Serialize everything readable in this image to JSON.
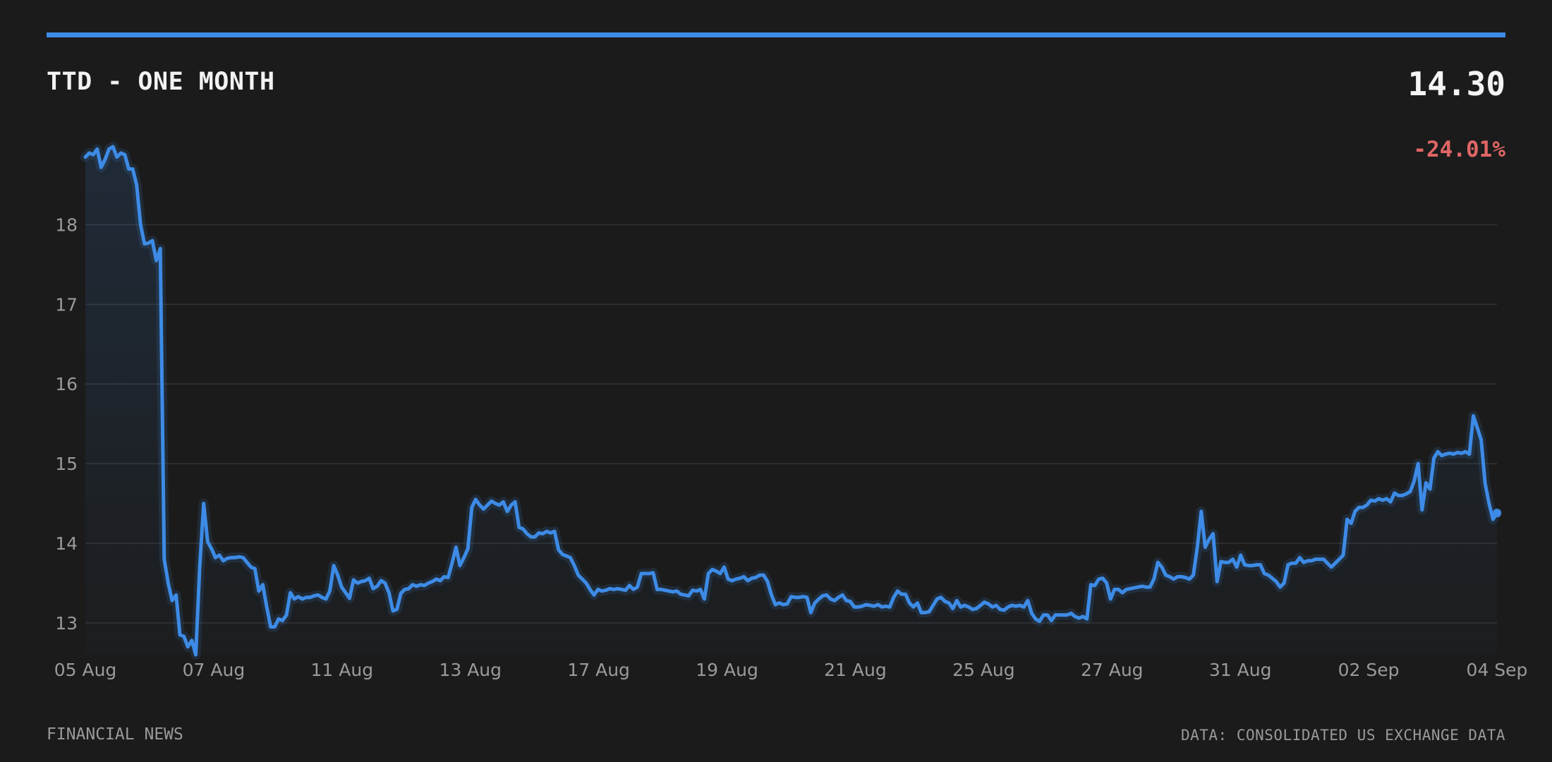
{
  "header": {
    "title": "TTD - ONE MONTH",
    "price": "14.30",
    "change": "-24.01%"
  },
  "footer": {
    "source": "FINANCIAL NEWS",
    "data_note": "DATA: CONSOLIDATED US EXCHANGE DATA"
  },
  "colors": {
    "background": "#1b1b1b",
    "accent": "#3d8be6",
    "negative": "#e06666",
    "grid": "#333333",
    "tick_text": "#9a9a9a"
  },
  "chart_data": {
    "type": "line",
    "title": "TTD - ONE MONTH",
    "ylim": [
      12.6,
      19.05
    ],
    "y_ticks": [
      13,
      14,
      15,
      16,
      17,
      18
    ],
    "x_ticks": [
      "05 Aug",
      "07 Aug",
      "11 Aug",
      "13 Aug",
      "17 Aug",
      "19 Aug",
      "21 Aug",
      "25 Aug",
      "27 Aug",
      "31 Aug",
      "02 Sep",
      "04 Sep"
    ],
    "grid": "horizontal",
    "series": [
      {
        "values": [
          18.85,
          18.9,
          18.88,
          18.95,
          18.72,
          18.82,
          18.95,
          18.98,
          18.85,
          18.9,
          18.88,
          18.7,
          18.7,
          18.5,
          18.0,
          17.76,
          17.77,
          17.8,
          17.55,
          17.7,
          13.8,
          13.5,
          13.28,
          13.35,
          12.85,
          12.83,
          12.7,
          12.78,
          12.6,
          13.7,
          14.5,
          14.02,
          13.93,
          13.82,
          13.85,
          13.78,
          13.81,
          13.82,
          13.82,
          13.83,
          13.82,
          13.76,
          13.7,
          13.68,
          13.4,
          13.48,
          13.2,
          12.95,
          12.95,
          13.05,
          13.03,
          13.1,
          13.38,
          13.3,
          13.33,
          13.3,
          13.32,
          13.32,
          13.34,
          13.35,
          13.32,
          13.3,
          13.4,
          13.72,
          13.6,
          13.45,
          13.38,
          13.31,
          13.54,
          13.5,
          13.52,
          13.53,
          13.56,
          13.43,
          13.46,
          13.53,
          13.5,
          13.38,
          13.15,
          13.17,
          13.37,
          13.42,
          13.43,
          13.48,
          13.46,
          13.48,
          13.47,
          13.5,
          13.52,
          13.55,
          13.53,
          13.58,
          13.57,
          13.75,
          13.95,
          13.72,
          13.82,
          13.93,
          14.45,
          14.55,
          14.48,
          14.43,
          14.48,
          14.53,
          14.5,
          14.48,
          14.52,
          14.4,
          14.48,
          14.52,
          14.2,
          14.18,
          14.12,
          14.08,
          14.08,
          14.13,
          14.12,
          14.15,
          14.13,
          14.15,
          13.92,
          13.86,
          13.84,
          13.82,
          13.72,
          13.6,
          13.55,
          13.5,
          13.42,
          13.35,
          13.42,
          13.4,
          13.41,
          13.43,
          13.42,
          13.43,
          13.42,
          13.41,
          13.47,
          13.42,
          13.45,
          13.62,
          13.62,
          13.62,
          13.63,
          13.42,
          13.42,
          13.41,
          13.4,
          13.39,
          13.4,
          13.36,
          13.35,
          13.34,
          13.41,
          13.4,
          13.42,
          13.3,
          13.62,
          13.67,
          13.65,
          13.62,
          13.7,
          13.55,
          13.53,
          13.55,
          13.56,
          13.58,
          13.53,
          13.56,
          13.57,
          13.6,
          13.6,
          13.52,
          13.35,
          13.23,
          13.25,
          13.23,
          13.24,
          13.33,
          13.32,
          13.32,
          13.33,
          13.32,
          13.13,
          13.25,
          13.3,
          13.34,
          13.35,
          13.3,
          13.28,
          13.32,
          13.35,
          13.28,
          13.27,
          13.2,
          13.2,
          13.21,
          13.23,
          13.22,
          13.21,
          13.23,
          13.2,
          13.21,
          13.2,
          13.32,
          13.4,
          13.36,
          13.36,
          13.25,
          13.2,
          13.25,
          13.13,
          13.13,
          13.14,
          13.22,
          13.3,
          13.32,
          13.27,
          13.25,
          13.18,
          13.28,
          13.2,
          13.22,
          13.2,
          13.17,
          13.18,
          13.22,
          13.26,
          13.24,
          13.2,
          13.22,
          13.17,
          13.16,
          13.2,
          13.22,
          13.21,
          13.22,
          13.2,
          13.28,
          13.12,
          13.05,
          13.02,
          13.1,
          13.1,
          13.03,
          13.1,
          13.1,
          13.1,
          13.1,
          13.12,
          13.08,
          13.06,
          13.08,
          13.05,
          13.48,
          13.47,
          13.55,
          13.56,
          13.5,
          13.3,
          13.42,
          13.42,
          13.38,
          13.42,
          13.43,
          13.44,
          13.45,
          13.46,
          13.45,
          13.45,
          13.55,
          13.76,
          13.7,
          13.6,
          13.58,
          13.55,
          13.58,
          13.58,
          13.57,
          13.55,
          13.6,
          13.95,
          14.4,
          13.95,
          14.05,
          14.12,
          13.52,
          13.77,
          13.76,
          13.76,
          13.8,
          13.7,
          13.85,
          13.73,
          13.72,
          13.72,
          13.73,
          13.73,
          13.62,
          13.6,
          13.56,
          13.52,
          13.45,
          13.5,
          13.73,
          13.75,
          13.75,
          13.82,
          13.76,
          13.78,
          13.78,
          13.8,
          13.8,
          13.8,
          13.75,
          13.7,
          13.75,
          13.8,
          13.85,
          14.3,
          14.25,
          14.4,
          14.45,
          14.45,
          14.48,
          14.54,
          14.53,
          14.56,
          14.54,
          14.56,
          14.52,
          14.63,
          14.6,
          14.6,
          14.62,
          14.65,
          14.78,
          15.0,
          14.42,
          14.76,
          14.68,
          15.07,
          15.15,
          15.1,
          15.12,
          15.13,
          15.12,
          15.14,
          15.13,
          15.15,
          15.12,
          15.6,
          15.45,
          15.3,
          14.75,
          14.5,
          14.3,
          14.38
        ]
      }
    ]
  }
}
